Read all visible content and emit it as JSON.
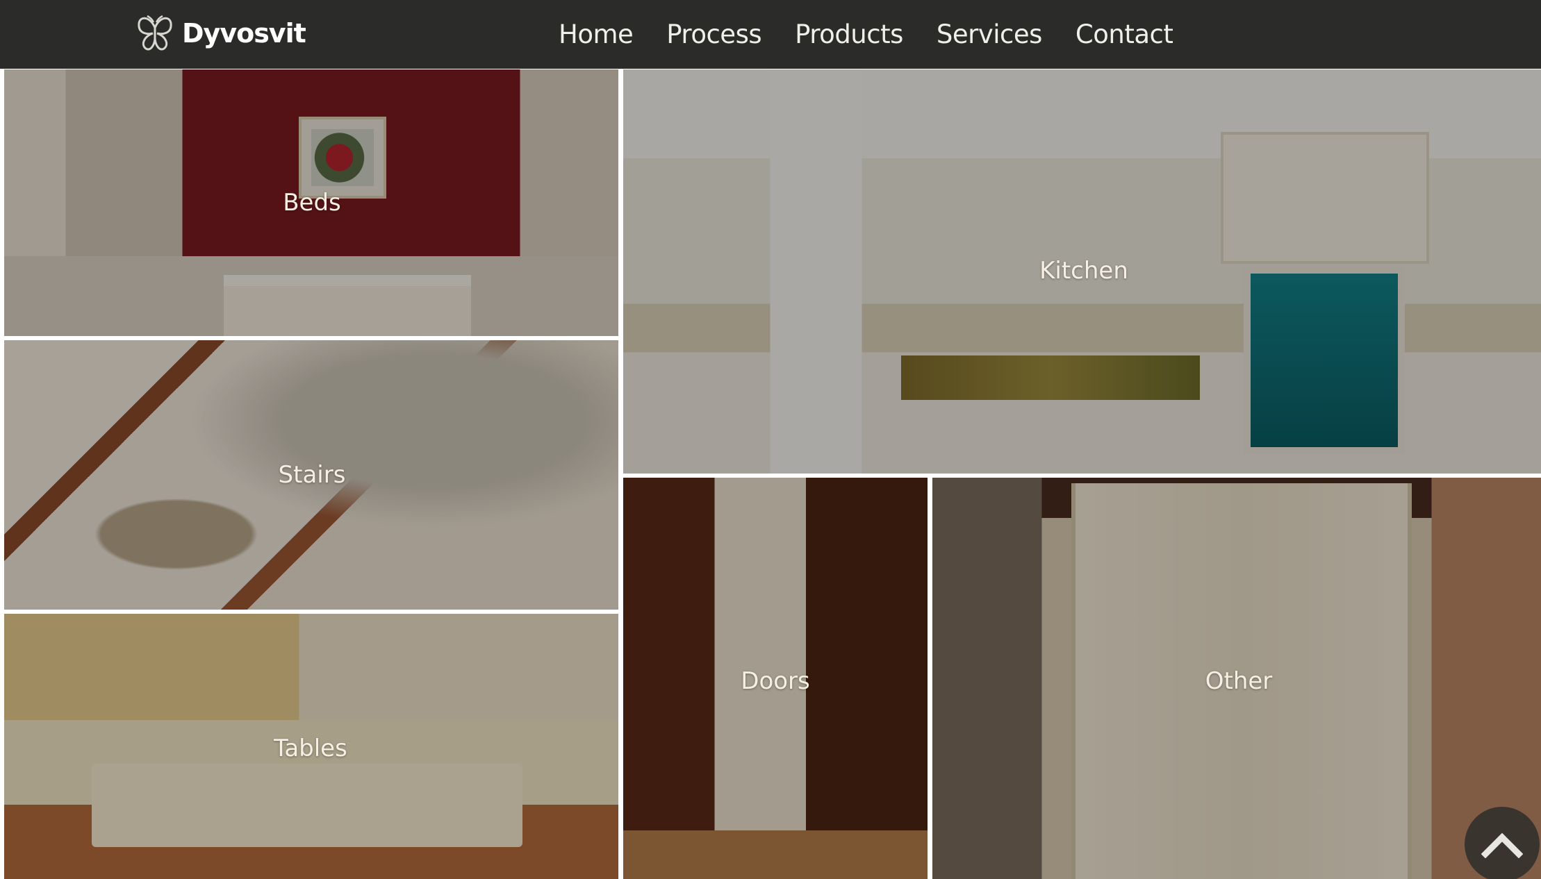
{
  "brand": {
    "name": "Dyvosvit",
    "logo_icon": "butterfly-icon"
  },
  "nav": {
    "items": [
      {
        "label": "Home"
      },
      {
        "label": "Process"
      },
      {
        "label": "Products"
      },
      {
        "label": "Services"
      },
      {
        "label": "Contact"
      }
    ]
  },
  "categories": {
    "beds": "Beds",
    "stairs": "Stairs",
    "tables": "Tables",
    "kitchen": "Kitchen",
    "doors": "Doors",
    "other": "Other"
  },
  "back_to_top": {
    "icon": "chevron-up-icon"
  },
  "colors": {
    "navbar_background": "#2b2c2a",
    "nav_text": "#f1efe9",
    "tile_label": "#f6efe3",
    "tile_gap": "#ffffff"
  }
}
